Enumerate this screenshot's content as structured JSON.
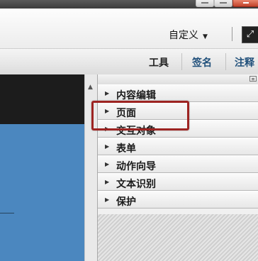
{
  "toolbar": {
    "customize_label": "自定义",
    "customize_caret": "▼",
    "expand_icon": "⤢"
  },
  "tabs": [
    {
      "label": "工具"
    },
    {
      "label": "签名"
    },
    {
      "label": "注释"
    }
  ],
  "panel": {
    "sections": [
      {
        "label": "内容编辑",
        "arrow": "▶"
      },
      {
        "label": "页面",
        "arrow": "▶"
      },
      {
        "label": "交互对象",
        "arrow": "▶"
      },
      {
        "label": "表单",
        "arrow": "▶"
      },
      {
        "label": "动作向导",
        "arrow": "▶"
      },
      {
        "label": "文本识别",
        "arrow": "▶"
      },
      {
        "label": "保护",
        "arrow": "▶"
      }
    ]
  },
  "scrollbar": {
    "up_arrow": "▲"
  },
  "colors": {
    "highlight": "#9d2422",
    "doc_blue": "#4b87bf",
    "tab_text": "#1f4f7a"
  }
}
